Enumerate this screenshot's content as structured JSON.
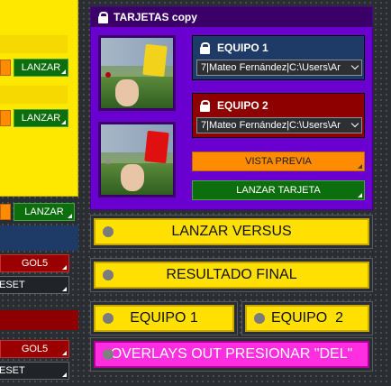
{
  "left_panels": {
    "lanzar_1": "LANZAR",
    "lanzar_2": "LANZAR",
    "lanzar_3": "LANZAR",
    "gol5_1": "GOL5",
    "reset_1": "ESET",
    "gol5_2": "GOL5",
    "reset_2": "ESET"
  },
  "tarjetas": {
    "title": "TARJETAS copy",
    "yellow_card_icon": "yellow-card-photo",
    "red_card_icon": "red-card-photo",
    "equipo1": {
      "label": "EQUIPO 1",
      "selected": "7|Mateo Fernández|C:\\Users\\Ar"
    },
    "equipo2": {
      "label": "EQUIPO 2",
      "selected": "7|Mateo Fernández|C:\\Users\\Ar"
    },
    "vista_previa": "VISTA PREVIA",
    "lanzar_tarjeta": "LANZAR TARJETA"
  },
  "actions": {
    "lanzar_versus": "LANZAR VERSUS",
    "resultado_final": "RESULTADO FINAL",
    "equipo1": "EQUIPO 1",
    "equipo2": "EQUIPO  2",
    "overlays_out": "OVERLAYS OUT PRESIONAR \"DEL\""
  },
  "colors": {
    "tarjetas_bg": "#6a00cf",
    "yellow": "#ffe000",
    "magenta": "#ff2ee0",
    "green": "#0d6e0d",
    "orange": "#ff8c00",
    "equipo1_bg": "#1e3a66",
    "equipo2_bg": "#8e0000"
  }
}
